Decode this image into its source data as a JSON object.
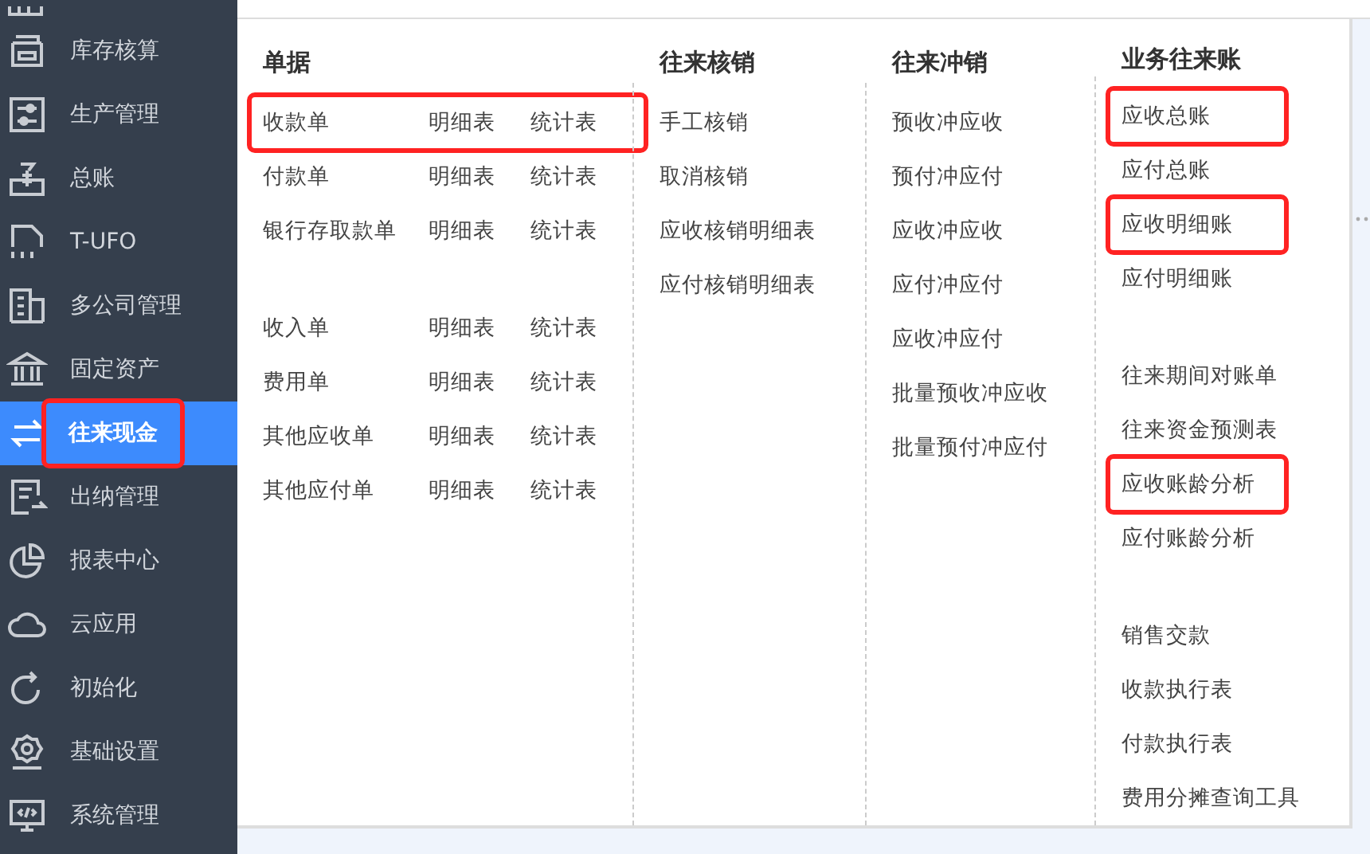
{
  "sidebar": {
    "items": [
      {
        "label": "库存核算",
        "selected": false,
        "highlighted": false
      },
      {
        "label": "生产管理",
        "selected": false,
        "highlighted": false
      },
      {
        "label": "总账",
        "selected": false,
        "highlighted": false
      },
      {
        "label": "T-UFO",
        "selected": false,
        "highlighted": false
      },
      {
        "label": "多公司管理",
        "selected": false,
        "highlighted": false
      },
      {
        "label": "固定资产",
        "selected": false,
        "highlighted": false
      },
      {
        "label": "往来现金",
        "selected": true,
        "highlighted": true
      },
      {
        "label": "出纳管理",
        "selected": false,
        "highlighted": false
      },
      {
        "label": "报表中心",
        "selected": false,
        "highlighted": false
      },
      {
        "label": "云应用",
        "selected": false,
        "highlighted": false
      },
      {
        "label": "初始化",
        "selected": false,
        "highlighted": false
      },
      {
        "label": "基础设置",
        "selected": false,
        "highlighted": false
      },
      {
        "label": "系统管理",
        "selected": false,
        "highlighted": false
      }
    ]
  },
  "menu": {
    "columns": [
      {
        "title": "单据",
        "groups": [
          {
            "items": [
              {
                "label": "收款单",
                "links": [
                  "明细表",
                  "统计表"
                ],
                "highlighted": true
              },
              {
                "label": "付款单",
                "links": [
                  "明细表",
                  "统计表"
                ],
                "highlighted": false
              },
              {
                "label": "银行存取款单",
                "links": [
                  "明细表",
                  "统计表"
                ],
                "highlighted": false
              }
            ]
          },
          {
            "items": [
              {
                "label": "收入单",
                "links": [
                  "明细表",
                  "统计表"
                ],
                "highlighted": false
              },
              {
                "label": "费用单",
                "links": [
                  "明细表",
                  "统计表"
                ],
                "highlighted": false
              },
              {
                "label": "其他应收单",
                "links": [
                  "明细表",
                  "统计表"
                ],
                "highlighted": false
              },
              {
                "label": "其他应付单",
                "links": [
                  "明细表",
                  "统计表"
                ],
                "highlighted": false
              }
            ]
          }
        ]
      },
      {
        "title": "往来核销",
        "groups": [
          {
            "items": [
              {
                "label": "手工核销",
                "highlighted": false
              },
              {
                "label": "取消核销",
                "highlighted": false
              },
              {
                "label": "应收核销明细表",
                "highlighted": false
              },
              {
                "label": "应付核销明细表",
                "highlighted": false
              }
            ]
          }
        ]
      },
      {
        "title": "往来冲销",
        "groups": [
          {
            "items": [
              {
                "label": "预收冲应收",
                "highlighted": false
              },
              {
                "label": "预付冲应付",
                "highlighted": false
              },
              {
                "label": "应收冲应收",
                "highlighted": false
              },
              {
                "label": "应付冲应付",
                "highlighted": false
              },
              {
                "label": "应收冲应付",
                "highlighted": false
              },
              {
                "label": "批量预收冲应收",
                "highlighted": false
              },
              {
                "label": "批量预付冲应付",
                "highlighted": false
              }
            ]
          }
        ]
      },
      {
        "title": "业务往来账",
        "groups": [
          {
            "items": [
              {
                "label": "应收总账",
                "highlighted": true
              },
              {
                "label": "应付总账",
                "highlighted": false
              },
              {
                "label": "应收明细账",
                "highlighted": true
              },
              {
                "label": "应付明细账",
                "highlighted": false
              }
            ]
          },
          {
            "items": [
              {
                "label": "往来期间对账单",
                "highlighted": false
              },
              {
                "label": "往来资金预测表",
                "highlighted": false
              },
              {
                "label": "应收账龄分析",
                "highlighted": true
              },
              {
                "label": "应付账龄分析",
                "highlighted": false
              }
            ]
          },
          {
            "items": [
              {
                "label": "销售交款",
                "highlighted": false
              },
              {
                "label": "收款执行表",
                "highlighted": false
              },
              {
                "label": "付款执行表",
                "highlighted": false
              },
              {
                "label": "费用分摊查询工具",
                "highlighted": false
              }
            ]
          }
        ]
      }
    ]
  }
}
